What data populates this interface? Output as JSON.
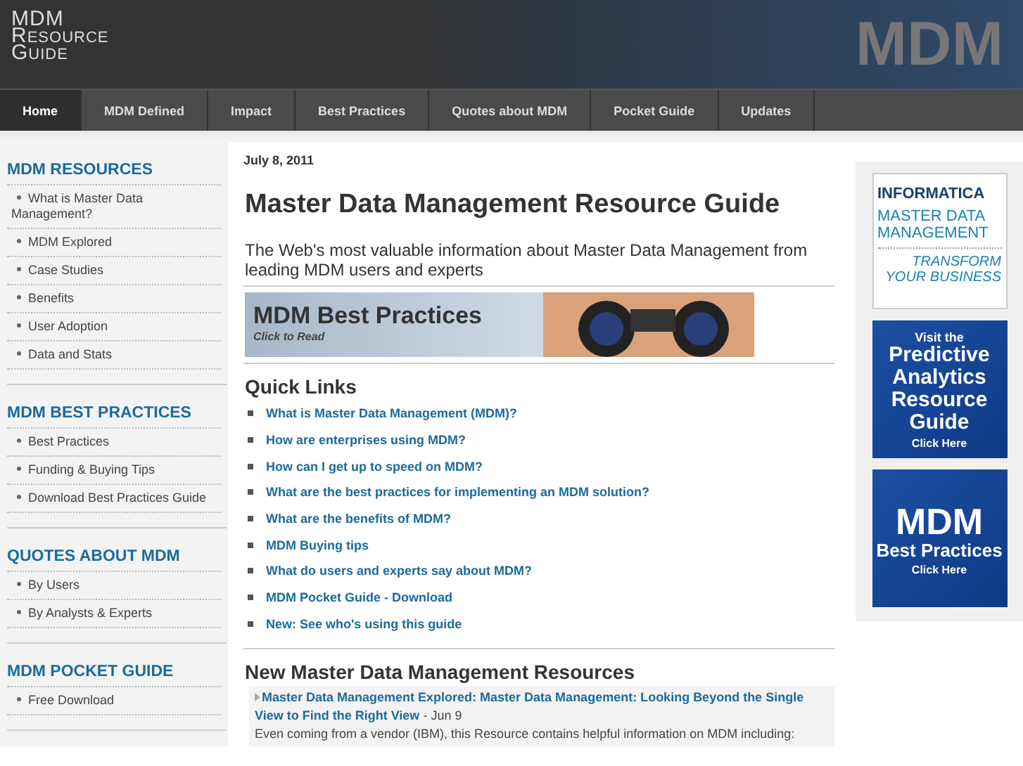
{
  "header": {
    "logo_lines": [
      "MDM",
      "Resource",
      "Guide"
    ],
    "banner_text": "MDM"
  },
  "nav": [
    {
      "label": "Home",
      "selected": true
    },
    {
      "label": "MDM Defined",
      "selected": false
    },
    {
      "label": "Impact",
      "selected": false
    },
    {
      "label": "Best Practices",
      "selected": false
    },
    {
      "label": "Quotes about MDM",
      "selected": false
    },
    {
      "label": "Pocket Guide",
      "selected": false
    },
    {
      "label": "Updates",
      "selected": false
    }
  ],
  "sidebar": [
    {
      "title": "MDM RESOURCES",
      "items": [
        "What is Master Data Management?",
        "MDM Explored",
        "Case Studies",
        "Benefits",
        "User Adoption",
        "Data and Stats"
      ]
    },
    {
      "title": "MDM BEST PRACTICES",
      "items": [
        "Best Practices",
        "Funding & Buying Tips",
        "Download Best Practices Guide"
      ]
    },
    {
      "title": "QUOTES ABOUT MDM",
      "items": [
        "By Users",
        "By Analysts & Experts"
      ]
    },
    {
      "title": "MDM POCKET GUIDE",
      "items": [
        "Free Download"
      ]
    }
  ],
  "main": {
    "date": "July 8, 2011",
    "title": "Master Data Management Resource Guide",
    "intro": "The Web's most valuable information about Master Data Management from leading MDM users and experts",
    "banner": {
      "title": "MDM Best Practices",
      "subtitle": "Click to Read"
    },
    "quick_links": {
      "title": "Quick Links",
      "links": [
        "What is Master Data Management (MDM)?",
        "How are enterprises using MDM?",
        "How can I get up to speed on MDM?",
        "What are the best practices for implementing an MDM solution?",
        "What are the benefits of MDM?",
        "MDM Buying tips",
        "What do users and experts say about MDM?",
        "MDM Pocket Guide - Download",
        "New: See who's using this guide"
      ]
    },
    "resources": {
      "title": "New Master Data Management Resources",
      "items": [
        {
          "link": "Master Data Management Explored: Master Data Management: Looking Beyond the Single View to Find the Right View",
          "date": "- Jun 9",
          "text": "Even coming from a vendor (IBM), this Resource contains helpful information on MDM including:"
        }
      ]
    }
  },
  "ads": [
    {
      "kind": "brand",
      "lines": [
        "INFORMATICA",
        "MASTER DATA MANAGEMENT",
        "TRANSFORM YOUR BUSINESS"
      ]
    },
    {
      "kind": "promo",
      "lines": [
        "Visit the",
        "Predictive Analytics Resource Guide",
        "Click Here"
      ]
    },
    {
      "kind": "promo",
      "lines": [
        "MDM",
        "Best Practices",
        "Click Here"
      ]
    }
  ]
}
